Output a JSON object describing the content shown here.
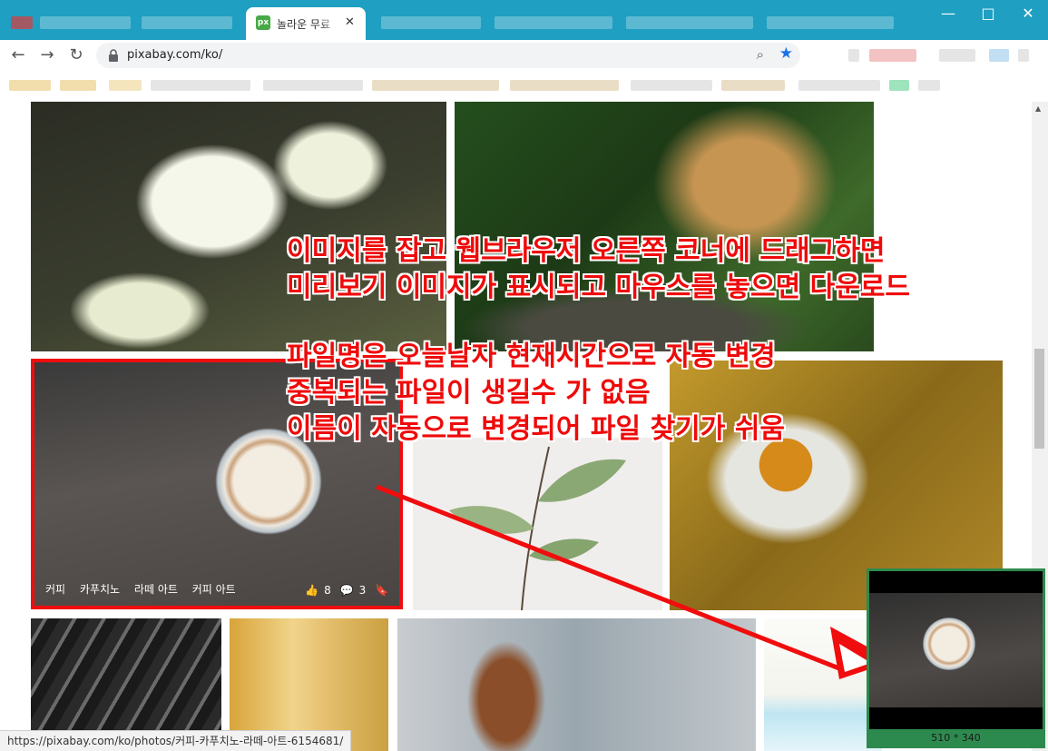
{
  "browser": {
    "tab_title": "놀라운 무료",
    "tab_icon_text": "px",
    "tab_close": "✕",
    "url": "pixabay.com/ko/",
    "status_url": "https://pixabay.com/ko/photos/커피-카푸치노-라떼-아트-6154681/"
  },
  "window_controls": {
    "minimize": "—",
    "maximize": "□",
    "close": "✕"
  },
  "coffee_card": {
    "tags": [
      "커피",
      "카푸치노",
      "라떼 아트",
      "커피 아트"
    ],
    "likes": "8",
    "comments": "3"
  },
  "annotations": {
    "line1": "이미지를 잡고 웹브라우저 오른쪽 코너에 드래그하면",
    "line2": "미리보기 이미지가 표시되고 마우스를 놓으면 다운로드",
    "line3": "파일명은 오늘날자 현재시간으로 자동 변경",
    "line4": "중복되는 파일이 생길수 가 없음",
    "line5": "이름이 자동으로 변경되어 파일 찾기가 쉬움"
  },
  "preview": {
    "dimensions": "510 * 340"
  },
  "colors": {
    "accent": "#ef0a0a",
    "tab_strip": "#1f9fc1",
    "preview_frame": "#2d8a4e"
  }
}
